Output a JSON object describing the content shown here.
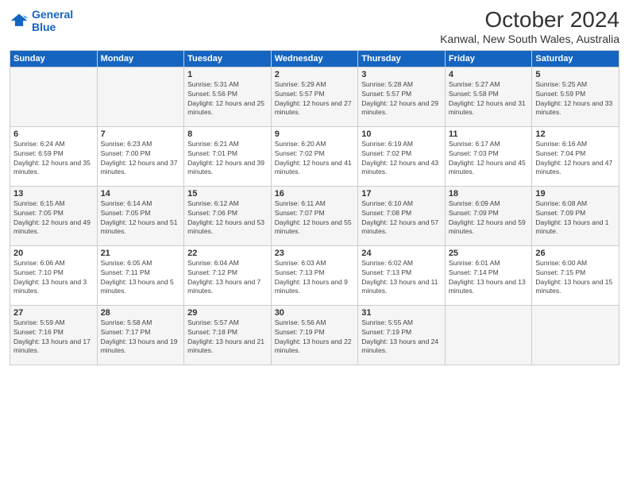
{
  "logo": {
    "line1": "General",
    "line2": "Blue"
  },
  "title": "October 2024",
  "subtitle": "Kanwal, New South Wales, Australia",
  "headers": [
    "Sunday",
    "Monday",
    "Tuesday",
    "Wednesday",
    "Thursday",
    "Friday",
    "Saturday"
  ],
  "weeks": [
    [
      {
        "day": "",
        "sunrise": "",
        "sunset": "",
        "daylight": ""
      },
      {
        "day": "",
        "sunrise": "",
        "sunset": "",
        "daylight": ""
      },
      {
        "day": "1",
        "sunrise": "Sunrise: 5:31 AM",
        "sunset": "Sunset: 5:56 PM",
        "daylight": "Daylight: 12 hours and 25 minutes."
      },
      {
        "day": "2",
        "sunrise": "Sunrise: 5:29 AM",
        "sunset": "Sunset: 5:57 PM",
        "daylight": "Daylight: 12 hours and 27 minutes."
      },
      {
        "day": "3",
        "sunrise": "Sunrise: 5:28 AM",
        "sunset": "Sunset: 5:57 PM",
        "daylight": "Daylight: 12 hours and 29 minutes."
      },
      {
        "day": "4",
        "sunrise": "Sunrise: 5:27 AM",
        "sunset": "Sunset: 5:58 PM",
        "daylight": "Daylight: 12 hours and 31 minutes."
      },
      {
        "day": "5",
        "sunrise": "Sunrise: 5:25 AM",
        "sunset": "Sunset: 5:59 PM",
        "daylight": "Daylight: 12 hours and 33 minutes."
      }
    ],
    [
      {
        "day": "6",
        "sunrise": "Sunrise: 6:24 AM",
        "sunset": "Sunset: 6:59 PM",
        "daylight": "Daylight: 12 hours and 35 minutes."
      },
      {
        "day": "7",
        "sunrise": "Sunrise: 6:23 AM",
        "sunset": "Sunset: 7:00 PM",
        "daylight": "Daylight: 12 hours and 37 minutes."
      },
      {
        "day": "8",
        "sunrise": "Sunrise: 6:21 AM",
        "sunset": "Sunset: 7:01 PM",
        "daylight": "Daylight: 12 hours and 39 minutes."
      },
      {
        "day": "9",
        "sunrise": "Sunrise: 6:20 AM",
        "sunset": "Sunset: 7:02 PM",
        "daylight": "Daylight: 12 hours and 41 minutes."
      },
      {
        "day": "10",
        "sunrise": "Sunrise: 6:19 AM",
        "sunset": "Sunset: 7:02 PM",
        "daylight": "Daylight: 12 hours and 43 minutes."
      },
      {
        "day": "11",
        "sunrise": "Sunrise: 6:17 AM",
        "sunset": "Sunset: 7:03 PM",
        "daylight": "Daylight: 12 hours and 45 minutes."
      },
      {
        "day": "12",
        "sunrise": "Sunrise: 6:16 AM",
        "sunset": "Sunset: 7:04 PM",
        "daylight": "Daylight: 12 hours and 47 minutes."
      }
    ],
    [
      {
        "day": "13",
        "sunrise": "Sunrise: 6:15 AM",
        "sunset": "Sunset: 7:05 PM",
        "daylight": "Daylight: 12 hours and 49 minutes."
      },
      {
        "day": "14",
        "sunrise": "Sunrise: 6:14 AM",
        "sunset": "Sunset: 7:05 PM",
        "daylight": "Daylight: 12 hours and 51 minutes."
      },
      {
        "day": "15",
        "sunrise": "Sunrise: 6:12 AM",
        "sunset": "Sunset: 7:06 PM",
        "daylight": "Daylight: 12 hours and 53 minutes."
      },
      {
        "day": "16",
        "sunrise": "Sunrise: 6:11 AM",
        "sunset": "Sunset: 7:07 PM",
        "daylight": "Daylight: 12 hours and 55 minutes."
      },
      {
        "day": "17",
        "sunrise": "Sunrise: 6:10 AM",
        "sunset": "Sunset: 7:08 PM",
        "daylight": "Daylight: 12 hours and 57 minutes."
      },
      {
        "day": "18",
        "sunrise": "Sunrise: 6:09 AM",
        "sunset": "Sunset: 7:09 PM",
        "daylight": "Daylight: 12 hours and 59 minutes."
      },
      {
        "day": "19",
        "sunrise": "Sunrise: 6:08 AM",
        "sunset": "Sunset: 7:09 PM",
        "daylight": "Daylight: 13 hours and 1 minute."
      }
    ],
    [
      {
        "day": "20",
        "sunrise": "Sunrise: 6:06 AM",
        "sunset": "Sunset: 7:10 PM",
        "daylight": "Daylight: 13 hours and 3 minutes."
      },
      {
        "day": "21",
        "sunrise": "Sunrise: 6:05 AM",
        "sunset": "Sunset: 7:11 PM",
        "daylight": "Daylight: 13 hours and 5 minutes."
      },
      {
        "day": "22",
        "sunrise": "Sunrise: 6:04 AM",
        "sunset": "Sunset: 7:12 PM",
        "daylight": "Daylight: 13 hours and 7 minutes."
      },
      {
        "day": "23",
        "sunrise": "Sunrise: 6:03 AM",
        "sunset": "Sunset: 7:13 PM",
        "daylight": "Daylight: 13 hours and 9 minutes."
      },
      {
        "day": "24",
        "sunrise": "Sunrise: 6:02 AM",
        "sunset": "Sunset: 7:13 PM",
        "daylight": "Daylight: 13 hours and 11 minutes."
      },
      {
        "day": "25",
        "sunrise": "Sunrise: 6:01 AM",
        "sunset": "Sunset: 7:14 PM",
        "daylight": "Daylight: 13 hours and 13 minutes."
      },
      {
        "day": "26",
        "sunrise": "Sunrise: 6:00 AM",
        "sunset": "Sunset: 7:15 PM",
        "daylight": "Daylight: 13 hours and 15 minutes."
      }
    ],
    [
      {
        "day": "27",
        "sunrise": "Sunrise: 5:59 AM",
        "sunset": "Sunset: 7:16 PM",
        "daylight": "Daylight: 13 hours and 17 minutes."
      },
      {
        "day": "28",
        "sunrise": "Sunrise: 5:58 AM",
        "sunset": "Sunset: 7:17 PM",
        "daylight": "Daylight: 13 hours and 19 minutes."
      },
      {
        "day": "29",
        "sunrise": "Sunrise: 5:57 AM",
        "sunset": "Sunset: 7:18 PM",
        "daylight": "Daylight: 13 hours and 21 minutes."
      },
      {
        "day": "30",
        "sunrise": "Sunrise: 5:56 AM",
        "sunset": "Sunset: 7:19 PM",
        "daylight": "Daylight: 13 hours and 22 minutes."
      },
      {
        "day": "31",
        "sunrise": "Sunrise: 5:55 AM",
        "sunset": "Sunset: 7:19 PM",
        "daylight": "Daylight: 13 hours and 24 minutes."
      },
      {
        "day": "",
        "sunrise": "",
        "sunset": "",
        "daylight": ""
      },
      {
        "day": "",
        "sunrise": "",
        "sunset": "",
        "daylight": ""
      }
    ]
  ]
}
